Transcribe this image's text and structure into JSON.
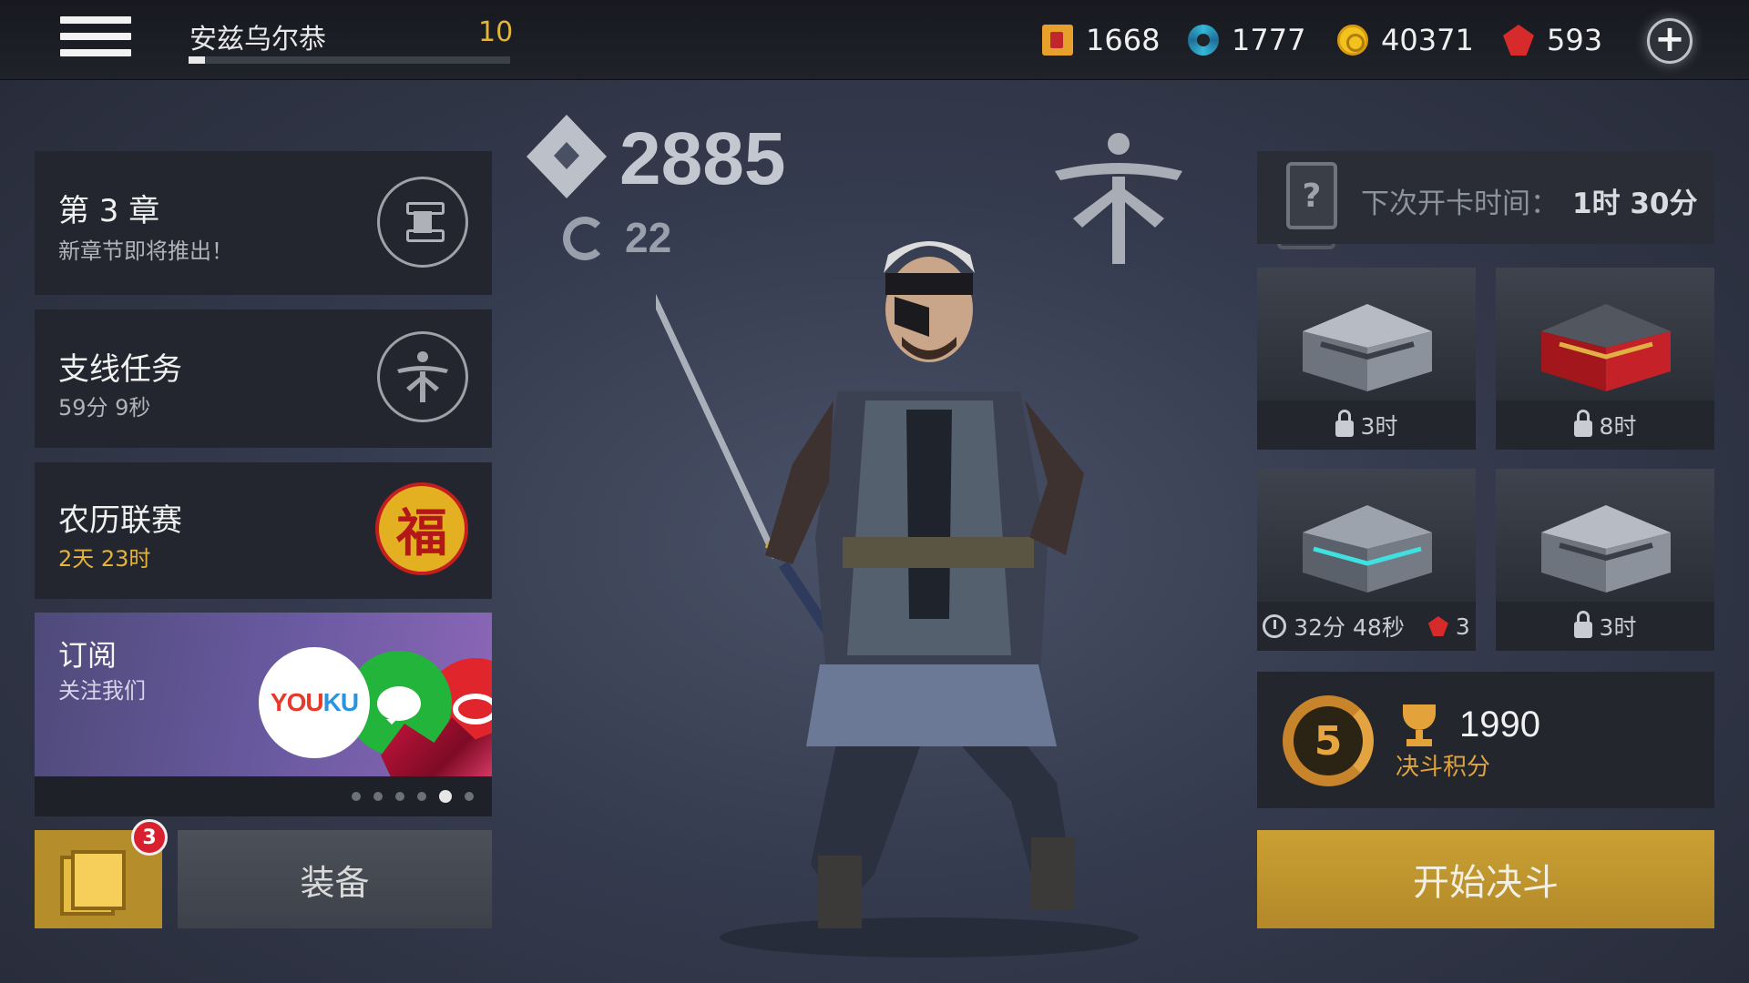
{
  "topbar": {
    "player_name": "安兹乌尔恭",
    "player_level": "10",
    "xp_progress": 0.05,
    "currencies": [
      {
        "icon": "ticket-icon",
        "value": "1668"
      },
      {
        "icon": "swirl-icon",
        "value": "1777"
      },
      {
        "icon": "coin-icon",
        "value": "40371"
      },
      {
        "icon": "gem-icon",
        "value": "593"
      }
    ]
  },
  "left": {
    "chapter": {
      "title": "第 3 章",
      "subtitle": "新章节即将推出！"
    },
    "side_quest": {
      "title": "支线任务",
      "subtitle": "59分 9秒"
    },
    "lunar": {
      "title": "农历联赛",
      "subtitle": "2天 23时",
      "badge_glyph": "福"
    },
    "subscribe": {
      "title": "订阅",
      "subtitle": "关注我们",
      "youku_a": "YOU",
      "youku_b": "KU"
    },
    "carousel_pages": 6,
    "carousel_active": 5,
    "cards_badge": "3",
    "equip_label": "装备"
  },
  "center": {
    "power": "2885",
    "swirl_count": "22"
  },
  "right": {
    "next_card_label": "下次开卡时间：",
    "next_card_time": "1时 30分",
    "chests": [
      {
        "type": "steel",
        "footer": "3时",
        "locked": true
      },
      {
        "type": "red",
        "footer": "8时",
        "locked": true
      },
      {
        "type": "steel-glow",
        "footer": "32分 48秒",
        "gem_cost": "3",
        "locked": false
      },
      {
        "type": "steel",
        "footer": "3时",
        "locked": true
      }
    ],
    "duel_rank": "5",
    "duel_score": "1990",
    "duel_label": "决斗积分",
    "start_label": "开始决斗"
  },
  "colors": {
    "gold": "#e3b43a",
    "gem_red": "#d72b2b",
    "panel": "#23262e"
  }
}
